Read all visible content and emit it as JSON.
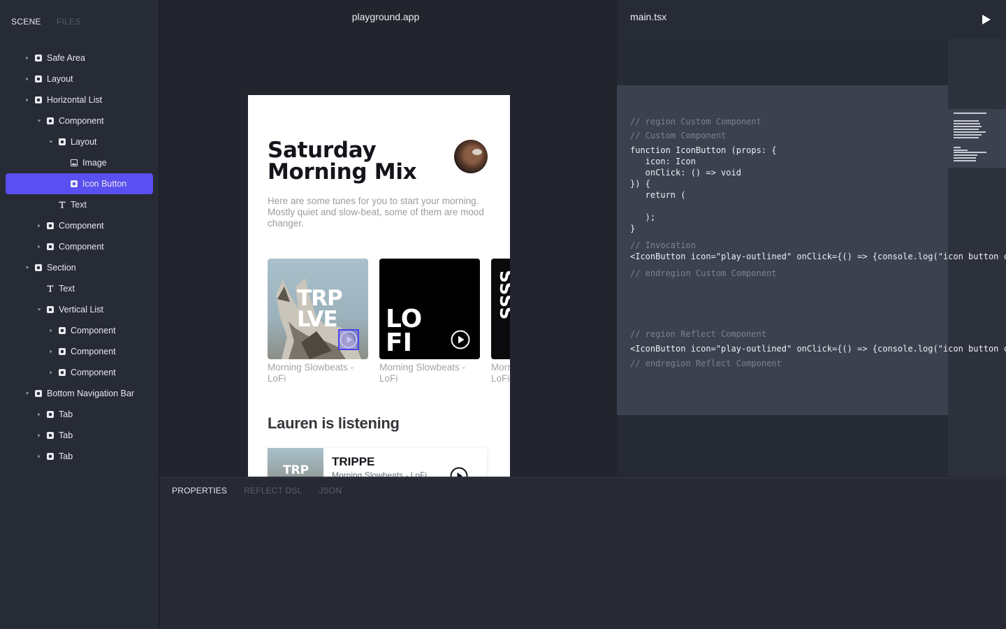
{
  "sidebar": {
    "tabs": [
      "SCENE",
      "FILES"
    ],
    "tree": [
      {
        "label": "Safe Area",
        "depth": 0,
        "caret": "right",
        "icon": "square"
      },
      {
        "label": "Layout",
        "depth": 0,
        "caret": "right",
        "icon": "square"
      },
      {
        "label": "Horizontal List",
        "depth": 0,
        "caret": "right",
        "icon": "square"
      },
      {
        "label": "Component",
        "depth": 1,
        "caret": "down",
        "icon": "square"
      },
      {
        "label": "Layout",
        "depth": 2,
        "caret": "down",
        "icon": "square"
      },
      {
        "label": "Image",
        "depth": 3,
        "caret": "none",
        "icon": "image"
      },
      {
        "label": "Icon Button",
        "depth": 3,
        "caret": "none",
        "icon": "square",
        "selected": true
      },
      {
        "label": "Text",
        "depth": 2,
        "caret": "none",
        "icon": "text"
      },
      {
        "label": "Component",
        "depth": 1,
        "caret": "right",
        "icon": "square"
      },
      {
        "label": "Component",
        "depth": 1,
        "caret": "right",
        "icon": "square"
      },
      {
        "label": "Section",
        "depth": 0,
        "caret": "down",
        "icon": "square"
      },
      {
        "label": "Text",
        "depth": 1,
        "caret": "none",
        "icon": "text"
      },
      {
        "label": "Vertical List",
        "depth": 1,
        "caret": "down",
        "icon": "square"
      },
      {
        "label": "Component",
        "depth": 2,
        "caret": "right",
        "icon": "square"
      },
      {
        "label": "Component",
        "depth": 2,
        "caret": "right",
        "icon": "square"
      },
      {
        "label": "Component",
        "depth": 2,
        "caret": "right",
        "icon": "square"
      },
      {
        "label": "Bottom Navigation Bar",
        "depth": 0,
        "caret": "down",
        "icon": "square"
      },
      {
        "label": "Tab",
        "depth": 1,
        "caret": "right",
        "icon": "square"
      },
      {
        "label": "Tab",
        "depth": 1,
        "caret": "right",
        "icon": "square"
      },
      {
        "label": "Tab",
        "depth": 1,
        "caret": "right",
        "icon": "square"
      }
    ]
  },
  "canvas": {
    "title": "playground.app",
    "phone": {
      "title_line1": "Saturday",
      "title_line2": "Morning Mix",
      "description": "Here are some tunes for you to start your morning. Mostly quiet and slow-beat, some of them are mood changer.",
      "cards": [
        {
          "cover_text_1": "TRP",
          "cover_text_2": "LVE",
          "label": "Morning Slowbeats - LoFi"
        },
        {
          "cover_text_1": "LO",
          "cover_text_2": "FI",
          "label": "Morning Slowbeats - LoFi"
        },
        {
          "cover_text_1": "SSSS",
          "cover_text_2": "",
          "label": "Morning Slowbeats - LoFi"
        }
      ],
      "section_title": "Lauren is listening",
      "list_item": {
        "thumb_text": "TRP",
        "title": "TRIPPE",
        "subtitle": "Morning Slowbeats - LoFi"
      }
    }
  },
  "code_panel": {
    "filename": "main.tsx",
    "lines": [
      {
        "text": "// region Custom Component",
        "comment": true,
        "gap": 0
      },
      {
        "text": "// Custom Component",
        "comment": true,
        "gap": 4
      },
      {
        "text": "function IconButton (props: {",
        "comment": false,
        "gap": 5
      },
      {
        "text": "   icon: Icon",
        "comment": false,
        "gap": 0
      },
      {
        "text": "   onClick: () => void",
        "comment": false,
        "gap": 0
      },
      {
        "text": "}) {",
        "comment": false,
        "gap": 0
      },
      {
        "text": "   return (",
        "comment": false,
        "gap": 0
      },
      {
        "text": "",
        "comment": false,
        "gap": 0
      },
      {
        "text": "   );",
        "comment": false,
        "gap": 0
      },
      {
        "text": "}",
        "comment": false,
        "gap": 0
      },
      {
        "text": "// Invocation",
        "comment": true,
        "gap": 8
      },
      {
        "text": "<IconButton icon=\"play-outlined\" onClick={() => {console.log(\"icon button clicked\")}} />",
        "comment": false,
        "gap": 0
      },
      {
        "text": "// endregion Custom Component",
        "comment": true,
        "gap": 8
      },
      {
        "text": "",
        "comment": false,
        "gap": 0
      },
      {
        "text": "",
        "comment": false,
        "gap": 0
      },
      {
        "text": "",
        "comment": false,
        "gap": 0
      },
      {
        "text": "",
        "comment": false,
        "gap": 0
      },
      {
        "text": "// region Reflect Component",
        "comment": true,
        "gap": 7
      },
      {
        "text": "<IconButton icon=\"play-outlined\" onClick={() => {console.log(\"icon button clicked\")}} />",
        "comment": false,
        "gap": 5
      },
      {
        "text": "// endregion Reflect Component",
        "comment": true,
        "gap": 5
      }
    ]
  },
  "bottom_panel": {
    "tabs": [
      "PROPERTIES",
      "REFLECT DSL",
      "JSON"
    ]
  },
  "colors": {
    "accent": "#5a4ff0",
    "sidebar_bg": "#272b36",
    "canvas_bg": "#22252d"
  }
}
